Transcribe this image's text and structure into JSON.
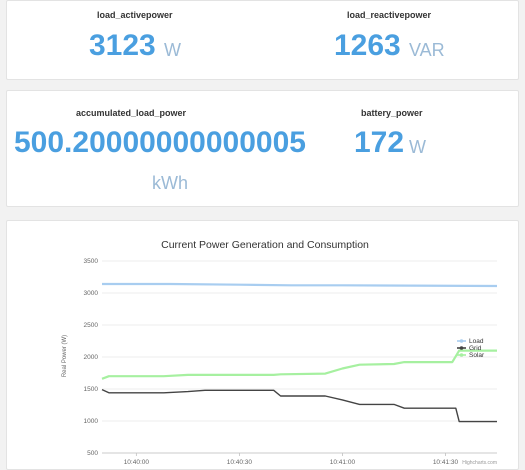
{
  "metrics_top": {
    "load_activepower": {
      "label": "load_activepower",
      "value": "3123",
      "unit": "W"
    },
    "load_reactivepower": {
      "label": "load_reactivepower",
      "value": "1263",
      "unit": "VAR"
    }
  },
  "metrics_mid": {
    "accumulated_load_power": {
      "label": "accumulated_load_power",
      "value": "500.20000000000005",
      "unit": "kWh"
    },
    "battery_power": {
      "label": "battery_power",
      "value": "172",
      "unit": "W"
    }
  },
  "colors": {
    "value_blue": "#4a9fe0",
    "load": "#a8cdf0",
    "grid": "#444444",
    "solar": "#a6f0a0"
  },
  "chart_data": {
    "type": "line",
    "title": "Current Power Generation and Consumption",
    "ylabel": "Real Power (W)",
    "ylim": [
      500,
      3500
    ],
    "yticks": [
      500,
      1000,
      1500,
      2000,
      2500,
      3000,
      3500
    ],
    "xticks": [
      "10:40:00",
      "10:40:30",
      "10:41:00",
      "10:41:30"
    ],
    "x_minutes": {
      "start": "10:39:50",
      "end": "10:41:45"
    },
    "credit": "Highcharts.com",
    "legend_position": "right",
    "series": [
      {
        "name": "Load",
        "color": "#a8cdf0",
        "points": [
          [
            "10:39:50",
            3140
          ],
          [
            "10:40:10",
            3140
          ],
          [
            "10:40:30",
            3130
          ],
          [
            "10:40:45",
            3120
          ],
          [
            "10:41:00",
            3120
          ],
          [
            "10:41:20",
            3115
          ],
          [
            "10:41:45",
            3110
          ]
        ]
      },
      {
        "name": "Grid",
        "color": "#444444",
        "points": [
          [
            "10:39:50",
            1490
          ],
          [
            "10:39:52",
            1440
          ],
          [
            "10:40:08",
            1440
          ],
          [
            "10:40:15",
            1460
          ],
          [
            "10:40:20",
            1480
          ],
          [
            "10:40:40",
            1480
          ],
          [
            "10:40:42",
            1390
          ],
          [
            "10:40:55",
            1390
          ],
          [
            "10:41:00",
            1330
          ],
          [
            "10:41:05",
            1260
          ],
          [
            "10:41:15",
            1260
          ],
          [
            "10:41:18",
            1200
          ],
          [
            "10:41:33",
            1200
          ],
          [
            "10:41:34",
            990
          ],
          [
            "10:41:45",
            990
          ]
        ]
      },
      {
        "name": "Solar",
        "color": "#a6f0a0",
        "points": [
          [
            "10:39:50",
            1660
          ],
          [
            "10:39:52",
            1700
          ],
          [
            "10:40:08",
            1700
          ],
          [
            "10:40:15",
            1720
          ],
          [
            "10:40:40",
            1720
          ],
          [
            "10:40:42",
            1730
          ],
          [
            "10:40:55",
            1740
          ],
          [
            "10:41:00",
            1820
          ],
          [
            "10:41:05",
            1880
          ],
          [
            "10:41:15",
            1890
          ],
          [
            "10:41:18",
            1920
          ],
          [
            "10:41:32",
            1920
          ],
          [
            "10:41:34",
            2100
          ],
          [
            "10:41:45",
            2100
          ]
        ]
      }
    ]
  }
}
